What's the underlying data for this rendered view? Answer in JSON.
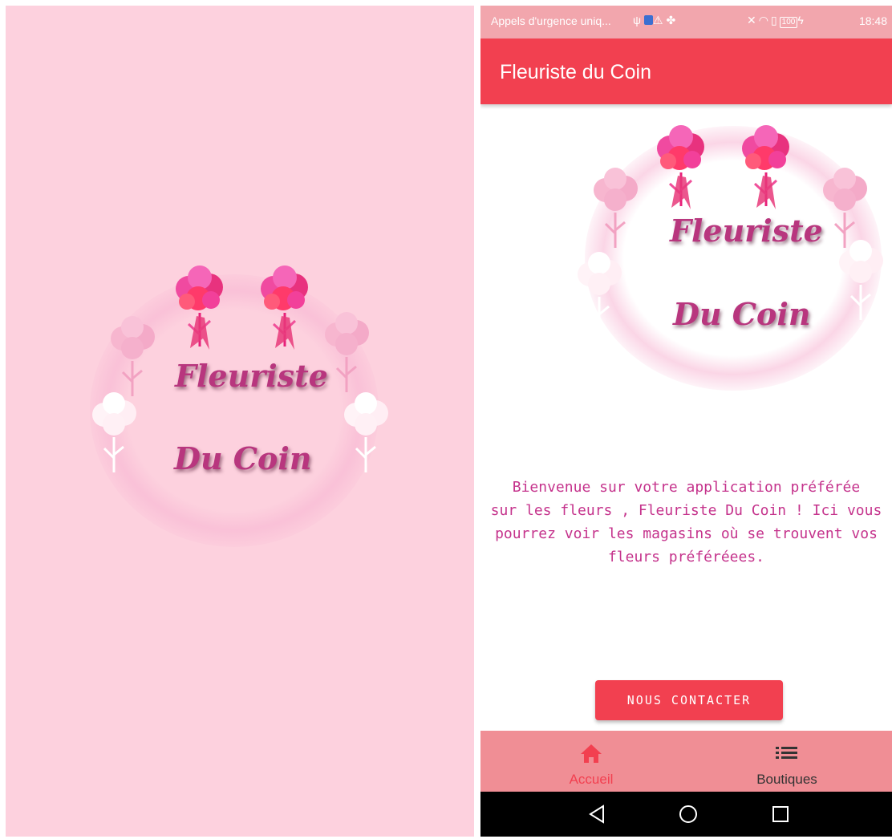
{
  "splash": {
    "logo_line1": "Fleuriste",
    "logo_line2": "Du Coin"
  },
  "status_bar": {
    "carrier": "Appels d'urgence uniq...",
    "battery": "100",
    "time": "18:48"
  },
  "app_bar": {
    "title": "Fleuriste du Coin"
  },
  "home": {
    "logo_line1": "Fleuriste",
    "logo_line2": "Du Coin",
    "welcome_lines": [
      "Bienvenue sur votre application préférée",
      "sur les fleurs , Fleuriste Du Coin ! Ici vous",
      "pourrez voir les magasins où se trouvent vos",
      "fleurs préféréees."
    ],
    "contact_button": "NOUS CONTACTER"
  },
  "bottom_nav": {
    "items": [
      {
        "label": "Accueil",
        "icon": "home-icon",
        "active": true
      },
      {
        "label": "Boutiques",
        "icon": "list-icon",
        "active": false
      }
    ]
  },
  "colors": {
    "splash_bg": "#fdd1de",
    "primary": "#f24050",
    "bottom_nav_bg": "#f08e95",
    "active_nav": "#f24050",
    "text_accent": "#c5338c",
    "logo_text": "#b8367e"
  }
}
